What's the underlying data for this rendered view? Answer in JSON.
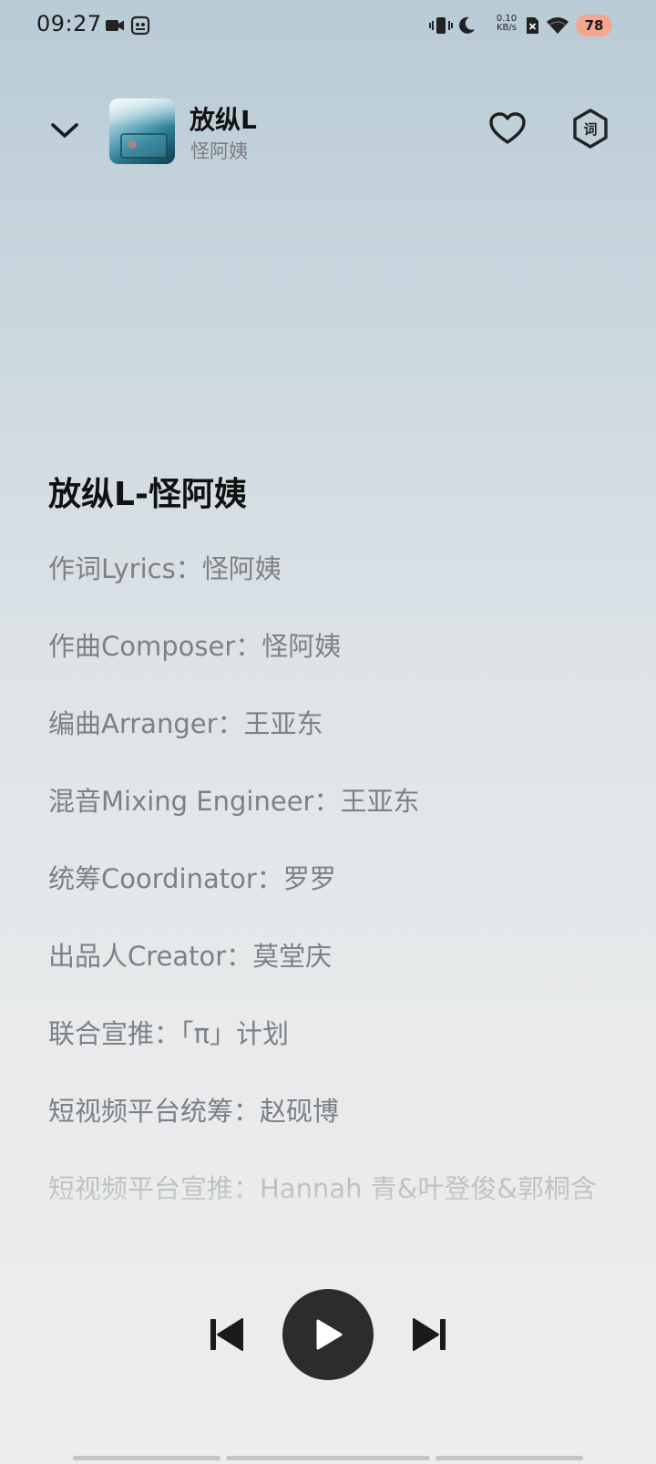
{
  "status_bar": {
    "time": "09:27",
    "net_speed_value": "0.10",
    "net_speed_unit": "KB/s",
    "battery": "78",
    "battery_color": "#f3a78f",
    "icons": [
      "video-camera-icon",
      "screen-record-icon",
      "vibrate-icon",
      "moon-icon",
      "no-sim-icon",
      "wifi-icon"
    ]
  },
  "header": {
    "song_title": "放纵L",
    "artist": "怪阿姨",
    "lyric_button_glyph": "词",
    "icons": [
      "chevron-down-icon",
      "heart-icon",
      "lyrics-hexagon-icon"
    ]
  },
  "lyrics": {
    "title": "放纵L-怪阿姨",
    "lines": [
      "作词Lyrics：怪阿姨",
      "作曲Composer：怪阿姨",
      "编曲Arranger：王亚东",
      "混音Mixing Engineer：王亚东",
      "统筹Coordinator：罗罗",
      "出品人Creator：莫堂庆",
      "联合宣推：「π」计划",
      "短视频平台统筹：赵砚博",
      "短视频平台宣推：Hannah 青&叶登俊&郭桐含"
    ]
  },
  "controls": {
    "icons": [
      "previous-track-icon",
      "play-icon",
      "next-track-icon"
    ],
    "play_button_color": "#2c2c2c"
  }
}
